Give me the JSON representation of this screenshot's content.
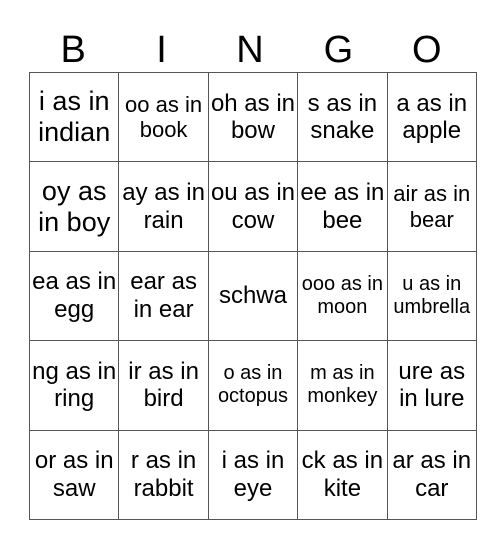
{
  "header": [
    "B",
    "I",
    "N",
    "G",
    "O"
  ],
  "rows": [
    [
      "i as in indian",
      "oo as in book",
      "oh as in bow",
      "s as in snake",
      "a as in apple"
    ],
    [
      "oy as in boy",
      "ay as in rain",
      "ou as in cow",
      "ee as in bee",
      "air as in bear"
    ],
    [
      "ea as in egg",
      "ear as in ear",
      "schwa",
      "ooo as in moon",
      "u as in umbrella"
    ],
    [
      "ng as in ring",
      "ir as in bird",
      "o as in octopus",
      "m as in monkey",
      "ure as in lure"
    ],
    [
      "or as in saw",
      "r as in rabbit",
      "i as in eye",
      "ck as in kite",
      "ar as in car"
    ]
  ]
}
